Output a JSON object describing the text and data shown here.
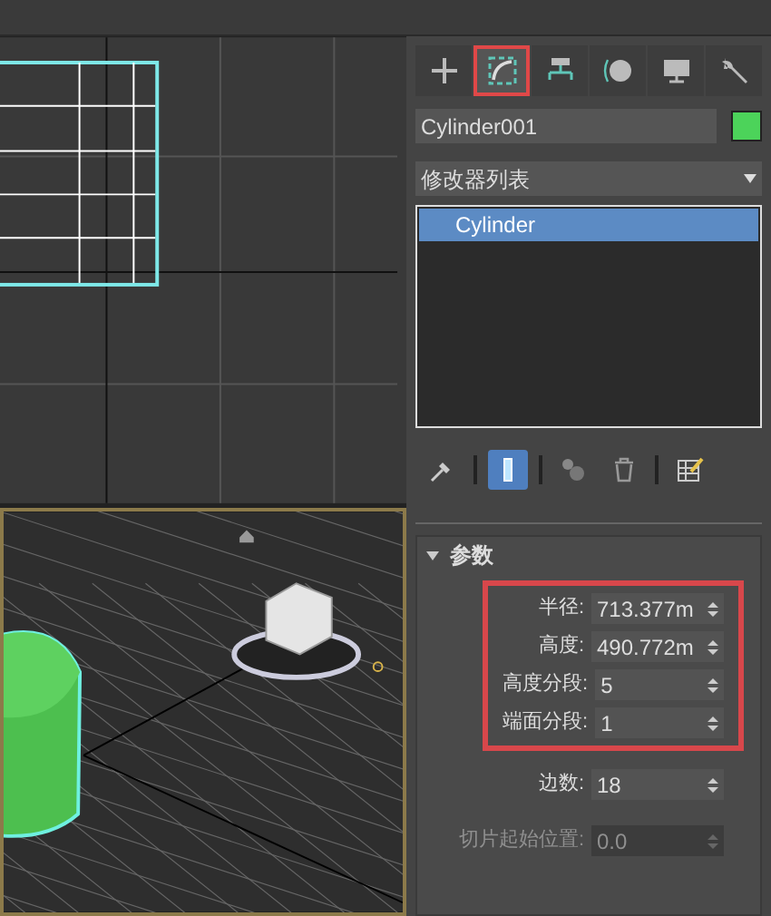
{
  "viewports": [
    {
      "kind": "top",
      "active": false
    },
    {
      "kind": "perspective",
      "active": true
    }
  ],
  "command_tabs": [
    {
      "kind": "create",
      "selected": false
    },
    {
      "kind": "modify",
      "selected": true
    },
    {
      "kind": "hierarchy",
      "selected": false
    },
    {
      "kind": "motion",
      "selected": false
    },
    {
      "kind": "display",
      "selected": false
    },
    {
      "kind": "utilities",
      "selected": false
    }
  ],
  "object_name": {
    "value": "Cylinder001",
    "color": "#4cd35a"
  },
  "modifier_list": {
    "label": "修改器列表"
  },
  "modifier_stack": [
    {
      "label": "Cylinder",
      "selected": true
    }
  ],
  "stack_tools": [
    {
      "kind": "pin",
      "selected": false
    },
    {
      "kind": "show-result",
      "selected": true
    },
    {
      "kind": "make-unique",
      "selected": false
    },
    {
      "kind": "remove",
      "selected": false
    },
    {
      "kind": "configure",
      "selected": false
    }
  ],
  "rollout": {
    "title": "参数",
    "expanded": true
  },
  "param_groups": [
    {
      "highlighted": true,
      "rows": [
        {
          "label": "半径:",
          "value": "713.377m",
          "disabled": false
        },
        {
          "label": "高度:",
          "value": "490.772m",
          "disabled": false
        },
        {
          "label": "高度分段:",
          "value": "5",
          "disabled": false
        },
        {
          "label": "端面分段:",
          "value": "1",
          "disabled": false
        }
      ]
    },
    {
      "highlighted": false,
      "rows": [
        {
          "label": "边数:",
          "value": "18",
          "disabled": false
        }
      ]
    },
    {
      "highlighted": false,
      "rows": [
        {
          "label": "切片起始位置:",
          "value": "0.0",
          "disabled": true
        }
      ]
    }
  ]
}
